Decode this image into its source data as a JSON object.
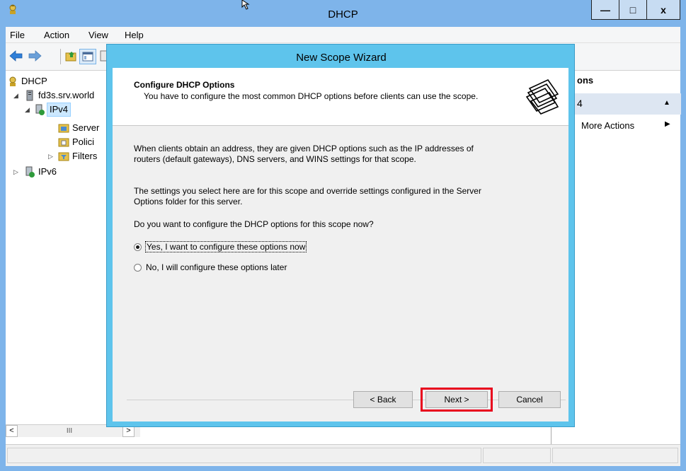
{
  "window": {
    "title": "DHCP",
    "minimize_glyph": "—",
    "maximize_glyph": "□",
    "close_glyph": "x"
  },
  "menu": [
    "File",
    "Action",
    "View",
    "Help"
  ],
  "tree": {
    "root": "DHCP",
    "server": "fd3s.srv.world",
    "ipv4": "IPv4",
    "server_options": "Server",
    "policies": "Polici",
    "filters": "Filters",
    "ipv6": "IPv6"
  },
  "actions": {
    "header": "ons",
    "section": "4",
    "more_actions": "More Actions"
  },
  "scroll": {
    "left": "<",
    "right": ">",
    "thumb": "III"
  },
  "wizard": {
    "title": "New Scope Wizard",
    "heading": "Configure DHCP Options",
    "subheading": "You have to configure the most common DHCP options before clients can use the scope.",
    "para1": "When clients obtain an address, they are given DHCP options such as the IP addresses of routers (default gateways), DNS servers, and WINS settings for that scope.",
    "para2": "The settings you select here are for this scope and override settings configured in the Server Options folder for this server.",
    "question": "Do you want to configure the DHCP options for this scope now?",
    "option_yes": "Yes, I want to configure these options now",
    "option_no": "No, I will configure these options later",
    "selected_option": "yes",
    "back_label": "< Back",
    "next_label": "Next >",
    "cancel_label": "Cancel"
  },
  "colors": {
    "titlebar": "#7eb4ea",
    "wizard_frame": "#5ec4ec",
    "highlight": "#e8001c"
  }
}
